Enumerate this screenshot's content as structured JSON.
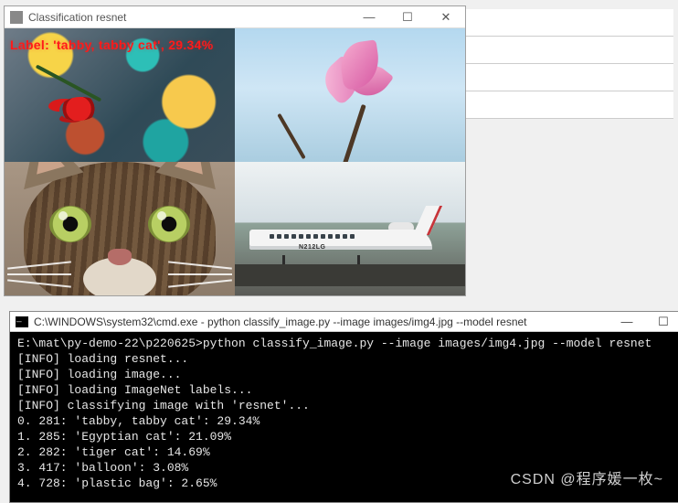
{
  "img_window": {
    "title": "Classification resnet",
    "overlay_label": "Label: 'tabby, tabby cat', 29.34%",
    "plane_reg": "N212LG"
  },
  "cmd_window": {
    "title": "C:\\WINDOWS\\system32\\cmd.exe - python  classify_image.py --image images/img4.jpg --model resnet",
    "prompt": "E:\\mat\\py-demo-22\\p220625>",
    "command": "python classify_image.py --image images/img4.jpg --model resnet",
    "lines": [
      "[INFO] loading resnet...",
      "[INFO] loading image...",
      "[INFO] loading ImageNet labels...",
      "[INFO] classifying image with 'resnet'...",
      "0. 281: 'tabby, tabby cat': 29.34%",
      "1. 285: 'Egyptian cat': 21.09%",
      "2. 282: 'tiger cat': 14.69%",
      "3. 417: 'balloon': 3.08%",
      "4. 728: 'plastic bag': 2.65%"
    ]
  },
  "watermark": "CSDN @程序媛一枚~"
}
